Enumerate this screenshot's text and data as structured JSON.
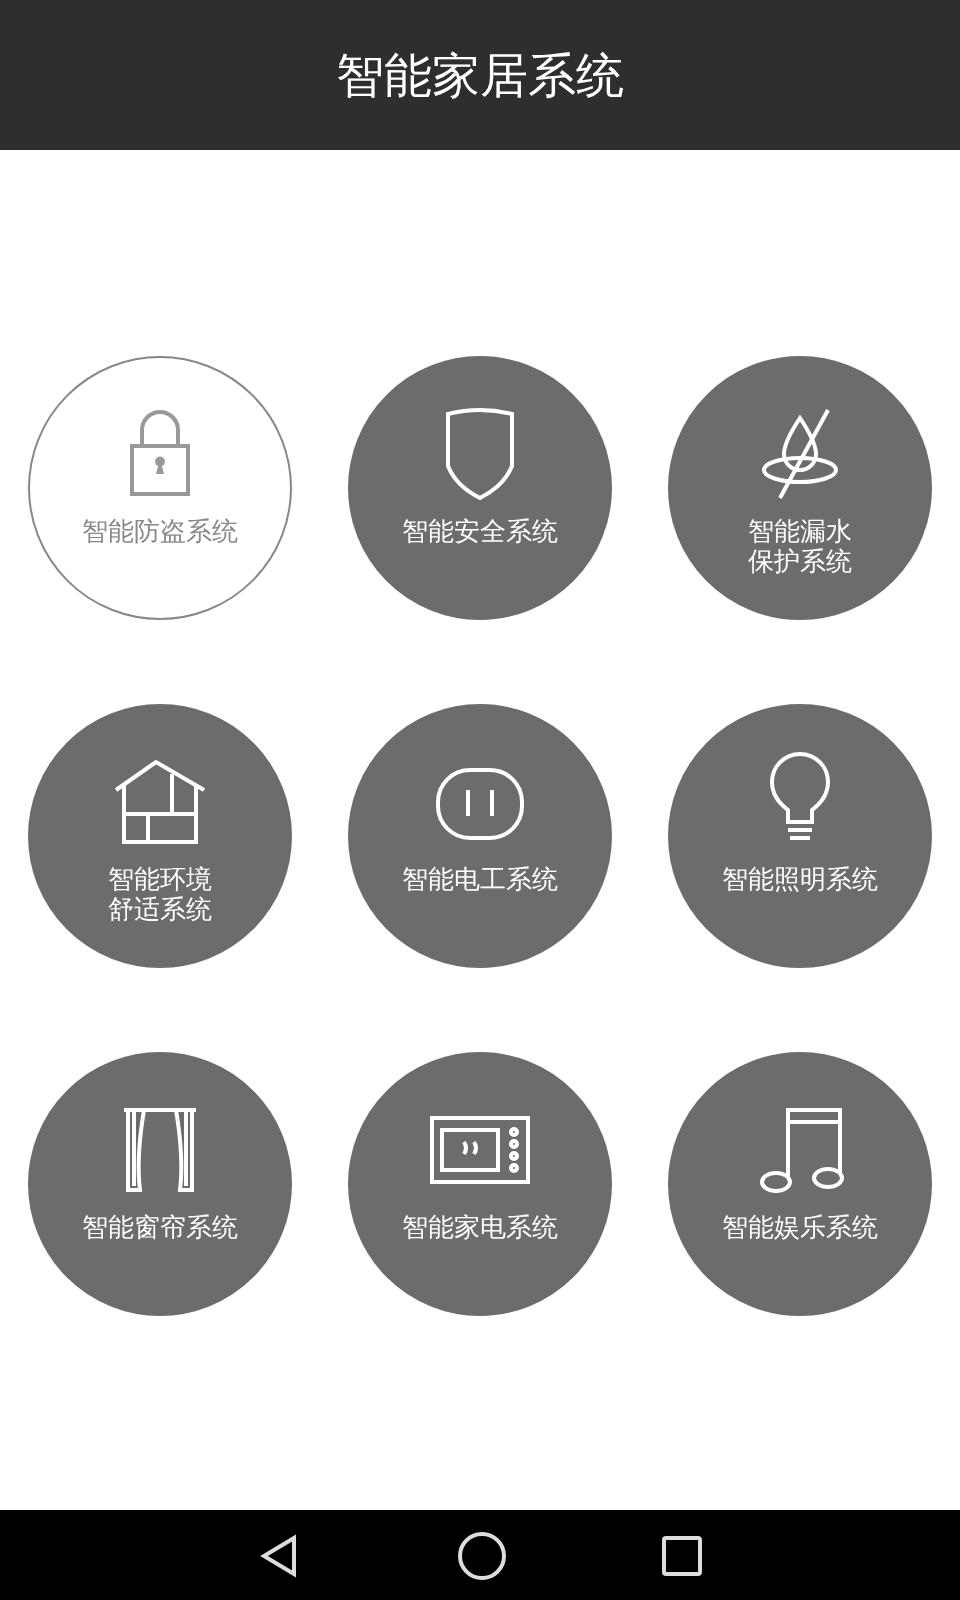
{
  "header": {
    "title": "智能家居系统"
  },
  "systems": [
    {
      "lines": [
        "智能防盗系统"
      ],
      "kind": "lock",
      "selected": true
    },
    {
      "lines": [
        "智能安全系统"
      ],
      "kind": "shield",
      "selected": false
    },
    {
      "lines": [
        "智能漏水",
        "保护系统"
      ],
      "kind": "water",
      "selected": false
    },
    {
      "lines": [
        "智能环境",
        "舒适系统"
      ],
      "kind": "house",
      "selected": false
    },
    {
      "lines": [
        "智能电工系统"
      ],
      "kind": "outlet",
      "selected": false
    },
    {
      "lines": [
        "智能照明系统"
      ],
      "kind": "bulb",
      "selected": false
    },
    {
      "lines": [
        "智能窗帘系统"
      ],
      "kind": "curtain",
      "selected": false
    },
    {
      "lines": [
        "智能家电系统"
      ],
      "kind": "microwave",
      "selected": false
    },
    {
      "lines": [
        "智能娱乐系统"
      ],
      "kind": "music",
      "selected": false
    }
  ]
}
